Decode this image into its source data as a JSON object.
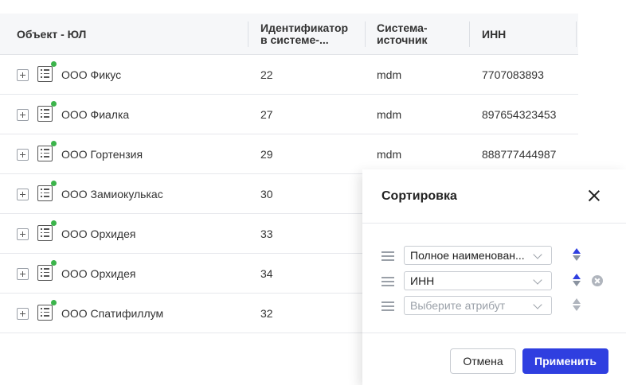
{
  "table": {
    "columns": [
      {
        "label": "Объект - ЮЛ"
      },
      {
        "label_line1": "Идентификатор",
        "label_line2": "в системе-..."
      },
      {
        "label_line1": "Система-",
        "label_line2": "источник"
      },
      {
        "label": "ИНН"
      }
    ],
    "rows": [
      {
        "name": "ООО Фикус",
        "id": "22",
        "source": "mdm",
        "inn": "7707083893"
      },
      {
        "name": "ООО Фиалка",
        "id": "27",
        "source": "mdm",
        "inn": "897654323453"
      },
      {
        "name": "ООО Гортензия",
        "id": "29",
        "source": "mdm",
        "inn": "888777444987"
      },
      {
        "name": "ООО Замиокулькас",
        "id": "30",
        "source": "",
        "inn": ""
      },
      {
        "name": "ООО Орхидея",
        "id": "33",
        "source": "",
        "inn": ""
      },
      {
        "name": "ООО Орхидея",
        "id": "34",
        "source": "",
        "inn": ""
      },
      {
        "name": "ООО Спатифиллум",
        "id": "32",
        "source": "",
        "inn": ""
      }
    ]
  },
  "sort_panel": {
    "title": "Сортировка",
    "rows": [
      {
        "value": "Полное наименован...",
        "is_placeholder": false
      },
      {
        "value": "ИНН",
        "is_placeholder": false
      },
      {
        "value": "Выберите атрибут",
        "is_placeholder": true
      }
    ],
    "cancel_label": "Отмена",
    "apply_label": "Применить"
  },
  "colors": {
    "accent": "#2f3fe0",
    "status_active": "#3cb44b",
    "header_bg": "#f6f7f9"
  },
  "icons": {
    "expand": "plus-square-icon",
    "entity": "document-list-icon",
    "status": "status-dot-icon",
    "close": "close-icon",
    "drag": "drag-handle-icon",
    "sort": "sort-arrows-icon",
    "remove": "remove-circle-icon",
    "dropdown": "chevron-down-icon"
  }
}
